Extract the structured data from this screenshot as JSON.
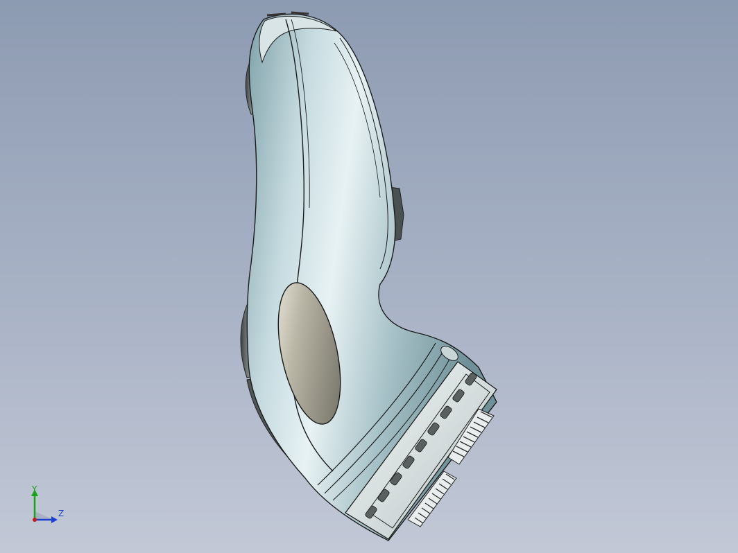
{
  "viewport": {
    "background_top": "#8d9bb2",
    "background_bottom": "#c2c8d6"
  },
  "model": {
    "body_color": "#a8c3c9",
    "trim_color": "#d7e3e6",
    "grip_color": "#5f6667",
    "head_color": "#e6ecec",
    "cutter_color": "#3a3a3a"
  },
  "triad": {
    "y_label": "Y",
    "z_label": "Z",
    "y_color": "#1aa31a",
    "z_color": "#1d3fd1",
    "origin_color": "#c41a1a"
  }
}
